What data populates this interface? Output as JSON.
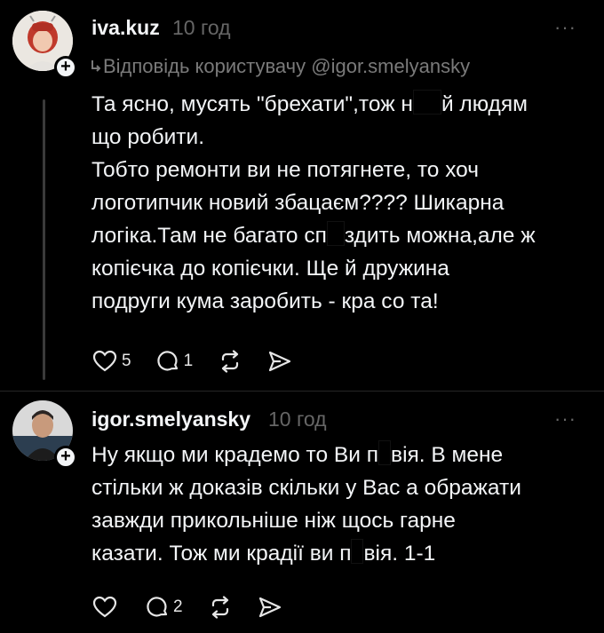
{
  "posts": [
    {
      "username": "iva.kuz",
      "time": "10 год",
      "reply_to": "Відповідь користувачу @igor.smelyansky",
      "lines": [
        [
          "Та ясно, мусять \"брехати\",тож н",
          "й людям"
        ],
        [
          "що робити."
        ],
        [
          "Тобто ремонти ви не потягнете, то хоч"
        ],
        [
          "логотипчик новий збацаєм???? Шикарна"
        ],
        [
          "логіка.Там не багато сп",
          "здить можна,але ж"
        ],
        [
          "копієчка до копієчки. Ще й дружина"
        ],
        [
          "подруги кума заробить - кра со та!"
        ]
      ],
      "likes": "5",
      "comments": "1"
    },
    {
      "username": "igor.smelyansky",
      "time": "10 год",
      "lines": [
        [
          "Ну якщо ми крадемо то Ви п",
          "вія. В мене"
        ],
        [
          "стільки ж доказів скільки у Вас а ображати"
        ],
        [
          "завжди прикольніше ніж щось гарне"
        ],
        [
          "казати. Тож ми крадії ви п",
          "вія. 1-1"
        ]
      ],
      "likes": "",
      "comments": "2"
    }
  ],
  "more_label": "···",
  "colors": {
    "background": "#000000",
    "text": "#f3f5f7",
    "muted": "#666666"
  },
  "icons": [
    "heart-icon",
    "comment-icon",
    "repost-icon",
    "share-icon",
    "plus-icon",
    "more-icon"
  ]
}
